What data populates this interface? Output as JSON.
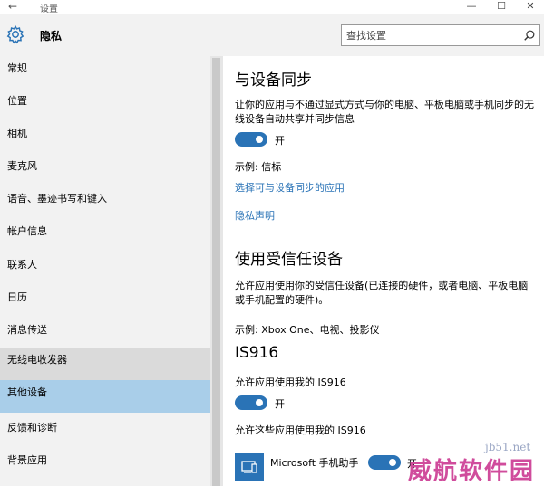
{
  "window": {
    "back_glyph": "←",
    "title": "设置",
    "minimize_glyph": "—",
    "maximize_glyph": "☐",
    "close_glyph": "✕"
  },
  "header": {
    "title": "隐私",
    "search_placeholder": "查找设置"
  },
  "sidebar": {
    "items": [
      {
        "label": "常规"
      },
      {
        "label": "位置"
      },
      {
        "label": "相机"
      },
      {
        "label": "麦克风"
      },
      {
        "label": "语音、墨迹书写和键入"
      },
      {
        "label": "帐户信息"
      },
      {
        "label": "联系人"
      },
      {
        "label": "日历"
      },
      {
        "label": "消息传送"
      },
      {
        "label": "无线电收发器"
      },
      {
        "label": "其他设备"
      },
      {
        "label": "反馈和诊断"
      },
      {
        "label": "背景应用"
      }
    ]
  },
  "sync": {
    "heading": "与设备同步",
    "description": "让你的应用与不通过显式方式与你的电脑、平板电脑或手机同步的无线设备自动共享并同步信息",
    "toggle_label": "开",
    "example": "示例: 信标",
    "choose_link": "选择可与设备同步的应用",
    "privacy_link": "隐私声明"
  },
  "trusted": {
    "heading": "使用受信任设备",
    "description": "允许应用使用你的受信任设备(已连接的硬件，或者电脑、平板电脑或手机配置的硬件)。",
    "example": "示例: Xbox One、电视、投影仪"
  },
  "device": {
    "heading": "IS916",
    "allow_text": "允许应用使用我的 IS916",
    "toggle_label": "开",
    "apps_text": "允许这些应用使用我的 IS916",
    "app_name": "Microsoft 手机助手",
    "app_toggle_label": "开"
  },
  "watermark": {
    "line1": "jb51.net",
    "line2": "威航软件园"
  },
  "colors": {
    "accent": "#2a73b6",
    "sidebar_bg": "#f2f2f2",
    "selected_bg": "#a9cee9"
  }
}
